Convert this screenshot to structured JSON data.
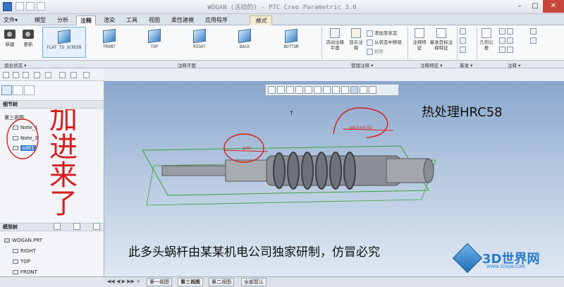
{
  "window": {
    "title": "WOGAN (活动的) - PTC Creo Parametric 3.0"
  },
  "tabs": [
    {
      "label": "文件▾"
    },
    {
      "label": "模型"
    },
    {
      "label": "分析"
    },
    {
      "label": "注释"
    },
    {
      "label": "渲染"
    },
    {
      "label": "工具"
    },
    {
      "label": "视图"
    },
    {
      "label": "柔性建模"
    },
    {
      "label": "应用程序"
    },
    {
      "label": "格式"
    }
  ],
  "ribbon": {
    "new_label": "新建",
    "update_label": "更新",
    "views": [
      {
        "label": "FLAT TO SCREEN"
      },
      {
        "label": "FRONT"
      },
      {
        "label": "TOP"
      },
      {
        "label": "RIGHT"
      },
      {
        "label": "BACK"
      },
      {
        "label": "BOTTOM"
      }
    ],
    "activate_plane": "活动注释平面",
    "show_annotations": "显示注释",
    "add_to_state": "添加至状态",
    "remove_from_state": "从状态中移除",
    "erase": "拭除",
    "annotation_feature": "注释特征",
    "annotation_target": "基准目标注释特征",
    "geometric_tolerance": "几何公差",
    "groups": {
      "combo_state": "组合状态 ▾",
      "annotation_plane": "注释平面",
      "manage_annotations": "管理注释 ▾",
      "annotation_feature": "注释特征 ▾",
      "datum": "基准 ▾",
      "annotation": "注释 ▾"
    }
  },
  "detail_tree": {
    "header": "细节树",
    "items": [
      {
        "label": "第三视图"
      },
      {
        "label": "Note_1"
      },
      {
        "label": "Note_3"
      },
      {
        "label": "ad61"
      }
    ]
  },
  "model_tree": {
    "header": "模型树",
    "items": [
      {
        "label": "WOGAN.PRT"
      },
      {
        "label": "RIGHT"
      },
      {
        "label": "TOP"
      },
      {
        "label": "FRONT"
      }
    ]
  },
  "handwritten": {
    "text": "加进来了"
  },
  "viewport": {
    "heat_treatment": "热处理HRC58",
    "dim1": "φ30",
    "dim2": "φ8.5±0.01",
    "caption": "此多头蜗杆由某某机电公司独家研制，仿冒必究",
    "watermark_main": "3D世界网",
    "watermark_url": "WWW.3DSJW.COM"
  },
  "sheets": [
    {
      "label": "第一视图"
    },
    {
      "label": "第三视图"
    },
    {
      "label": "第二视图"
    },
    {
      "label": "全部暂认"
    }
  ],
  "colors": {
    "viewport_top": "#89a7cc",
    "viewport_bottom": "#dfe8f2",
    "annotation_red": "#e02020",
    "ink": "#d81e1e"
  }
}
